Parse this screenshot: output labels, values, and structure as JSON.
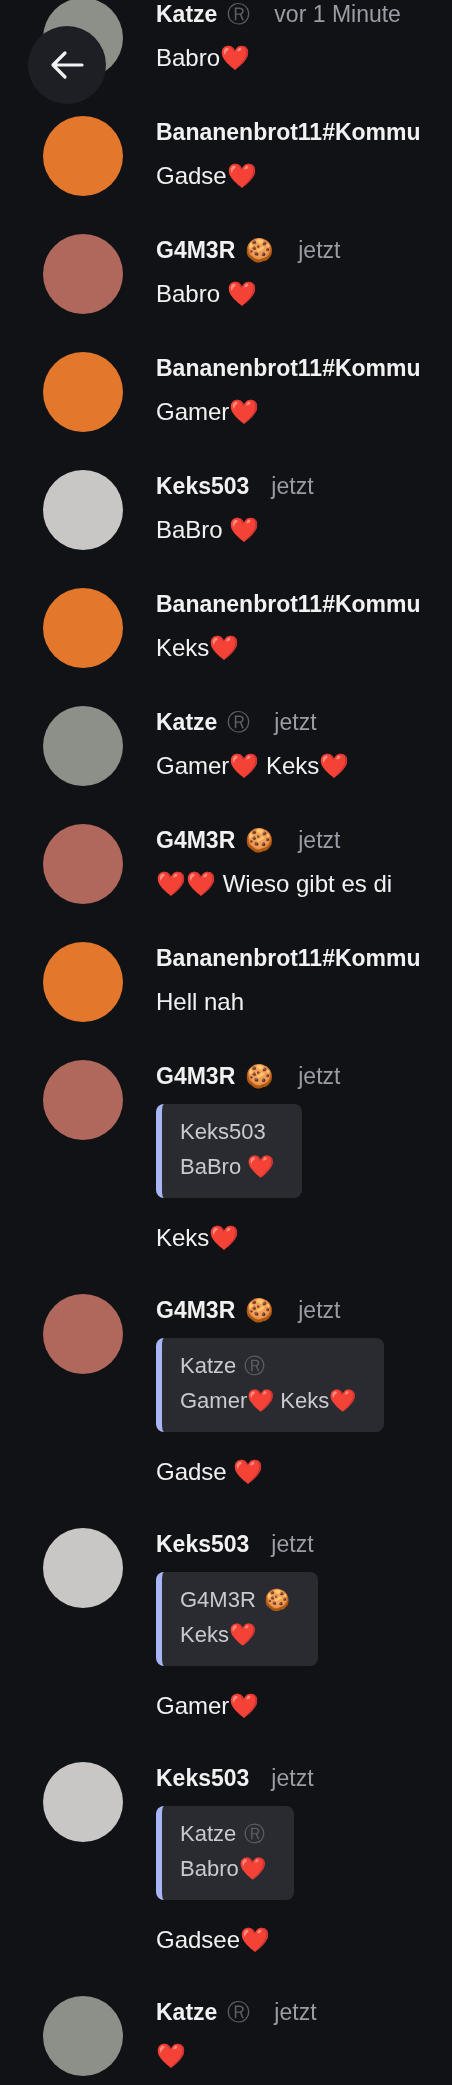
{
  "messages": [
    {
      "author": "Katze",
      "badge": "Ⓡ",
      "time": "vor 1 Minute",
      "color": "#8d9088",
      "text": "Babro❤️"
    },
    {
      "author": "Bananenbrot11#Kommu",
      "color": "#e3782c",
      "text": "Gadse❤️"
    },
    {
      "author": "G4M3R",
      "badge": "🍪",
      "time": "jetzt",
      "color": "#b0685c",
      "text": "Babro ❤️"
    },
    {
      "author": "Bananenbrot11#Kommu",
      "color": "#e3782c",
      "text": "Gamer❤️"
    },
    {
      "author": "Keks503",
      "time": "jetzt",
      "color": "#c9c6c6",
      "text": "BaBro ❤️"
    },
    {
      "author": "Bananenbrot11#Kommu",
      "color": "#e3782c",
      "text": "Keks❤️"
    },
    {
      "author": "Katze",
      "badge": "Ⓡ",
      "time": "jetzt",
      "color": "#8d9088",
      "text": "Gamer❤️ Keks❤️"
    },
    {
      "author": "G4M3R",
      "badge": "🍪",
      "time": "jetzt",
      "color": "#b0685c",
      "text": "❤️❤️ Wieso gibt es di"
    },
    {
      "author": "Bananenbrot11#Kommu",
      "color": "#e3782c",
      "text": "Hell nah"
    },
    {
      "author": "G4M3R",
      "badge": "🍪",
      "time": "jetzt",
      "color": "#b0685c",
      "quote": {
        "author": "Keks503",
        "text": "BaBro ❤️"
      },
      "text": "Keks❤️"
    },
    {
      "author": "G4M3R",
      "badge": "🍪",
      "time": "jetzt",
      "color": "#b0685c",
      "quote": {
        "author": "Katze",
        "badge": "Ⓡ",
        "text": "Gamer❤️ Keks❤️"
      },
      "text": "Gadse ❤️"
    },
    {
      "author": "Keks503",
      "time": "jetzt",
      "color": "#c9c6c6",
      "quote": {
        "author": "G4M3R",
        "badge": "🍪",
        "text": "Keks❤️"
      },
      "text": "Gamer❤️"
    },
    {
      "author": "Keks503",
      "time": "jetzt",
      "color": "#c9c6c6",
      "quote": {
        "author": "Katze",
        "badge": "Ⓡ",
        "text": "Babro❤️"
      },
      "text": "Gadsee❤️"
    },
    {
      "author": "Katze",
      "badge": "Ⓡ",
      "time": "jetzt",
      "color": "#8d9088",
      "text": "❤️"
    }
  ]
}
